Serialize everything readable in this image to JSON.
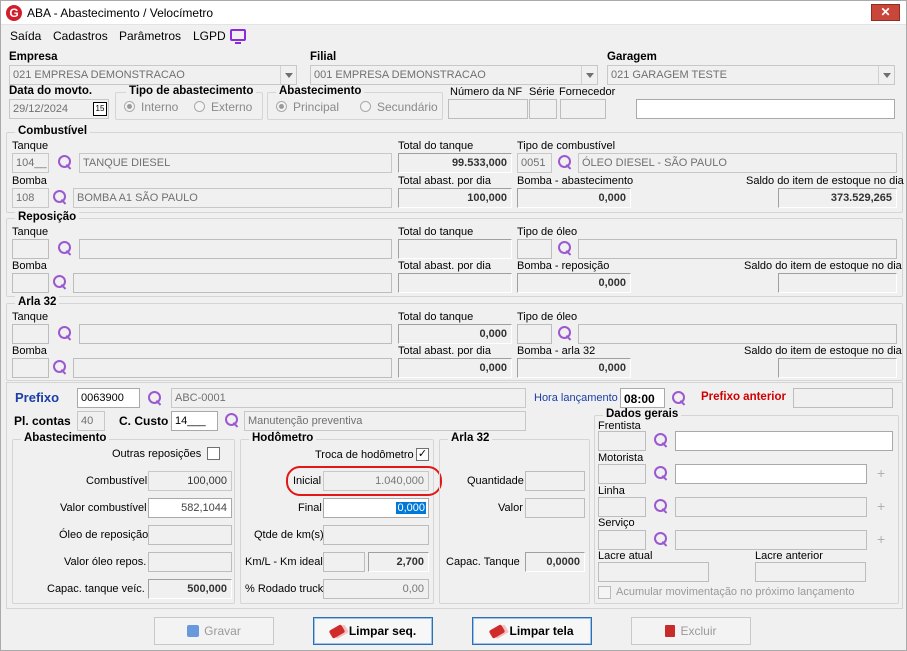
{
  "window": {
    "title": "ABA - Abastecimento / Velocímetro",
    "close_label": "✕"
  },
  "menu": [
    {
      "label": "Saída"
    },
    {
      "label": "Cadastros"
    },
    {
      "label": "Parâmetros"
    },
    {
      "label": "LGPD"
    }
  ],
  "header": {
    "empresa_label": "Empresa",
    "empresa_value": "021 EMPRESA DEMONSTRACAO",
    "filial_label": "Filial",
    "filial_value": "001 EMPRESA DEMONSTRACAO",
    "garagem_label": "Garagem",
    "garagem_value": "021 GARAGEM TESTE",
    "data_label": "Data do movto.",
    "data_value": "29/12/2024",
    "date_btn": "15",
    "tipo_label": "Tipo de abastecimento",
    "tipo_interno": "Interno",
    "tipo_externo": "Externo",
    "abast_label": "Abastecimento",
    "abast_principal": "Principal",
    "abast_secundario": "Secundário",
    "nf_label": "Número da NF",
    "serie_label": "Série",
    "fornecedor_label": "Fornecedor"
  },
  "combustivel": {
    "title": "Combustível",
    "tanque_label": "Tanque",
    "tanque_code": "104__",
    "tanque_name": "TANQUE DIESEL",
    "total_tanque_label": "Total do tanque",
    "total_tanque": "99.533,000",
    "tipo_label": "Tipo de combustível",
    "tipo_code": "0051",
    "tipo_name": "ÓLEO DIESEL - SÃO PAULO",
    "bomba_label": "Bomba",
    "bomba_code": "108",
    "bomba_name": "BOMBA A1 SÃO PAULO",
    "total_abast_label": "Total abast. por dia",
    "total_abast": "100,000",
    "bomba_abast_label": "Bomba - abastecimento",
    "bomba_abast": "0,000",
    "saldo_label": "Saldo do item de estoque no dia",
    "saldo": "373.529,265"
  },
  "reposicao": {
    "title": "Reposição",
    "tanque_label": "Tanque",
    "total_tanque_label": "Total do tanque",
    "tipo_label": "Tipo de óleo",
    "bomba_label": "Bomba",
    "total_abast_label": "Total abast. por dia",
    "bomba_rep_label": "Bomba - reposição",
    "bomba_rep": "0,000",
    "saldo_label": "Saldo do item de estoque no dia"
  },
  "arla": {
    "title": "Arla 32",
    "tanque_label": "Tanque",
    "total_tanque_label": "Total do tanque",
    "total_tanque": "0,000",
    "tipo_label": "Tipo de óleo",
    "bomba_label": "Bomba",
    "total_abast_label": "Total abast. por dia",
    "total_abast": "0,000",
    "bomba_arla_label": "Bomba - arla 32",
    "bomba_arla": "0,000",
    "saldo_label": "Saldo do item de estoque no dia"
  },
  "prefixo": {
    "label": "Prefixo",
    "code": "0063900",
    "name": "ABC-0001",
    "hora_label": "Hora lançamento",
    "hora": "08:00",
    "anterior_label": "Prefixo anterior",
    "pl_contas_label": "Pl. contas",
    "pl_contas": "40",
    "custo_label": "C. Custo",
    "custo_code": "14___",
    "custo_name": "Manutenção preventiva"
  },
  "abastecimento": {
    "title": "Abastecimento",
    "outras_label": "Outras reposições",
    "combustivel_label": "Combustível",
    "combustivel": "100,000",
    "valor_label": "Valor combustível",
    "valor": "582,1044",
    "oleo_label": "Óleo de reposição",
    "valor_oleo_label": "Valor óleo repos.",
    "capac_label": "Capac. tanque veíc.",
    "capac": "500,000"
  },
  "hodometro": {
    "title": "Hodômetro",
    "troca_label": "Troca de hodômetro",
    "troca_mark": "✓",
    "inicial_label": "Inicial",
    "inicial": "1.040,000",
    "final_label": "Final",
    "final": "0,000",
    "qtde_label": "Qtde de km(s)",
    "kml_label": "Km/L - Km ideal",
    "kml": "2,700",
    "rodado_label": "% Rodado truck",
    "rodado": "0,00"
  },
  "arla32": {
    "title": "Arla 32",
    "quantidade_label": "Quantidade",
    "valor_label": "Valor",
    "capac_label": "Capac. Tanque",
    "capac": "0,0000"
  },
  "dados_gerais": {
    "title": "Dados gerais",
    "frentista_label": "Frentista",
    "motorista_label": "Motorista",
    "linha_label": "Linha",
    "servico_label": "Serviço",
    "lacre_atual_label": "Lacre atual",
    "lacre_anterior_label": "Lacre anterior",
    "acumular_label": "Acumular movimentação no próximo lançamento"
  },
  "buttons": {
    "gravar": "Gravar",
    "limpar_seq": "Limpar seq.",
    "limpar_tela": "Limpar tela",
    "excluir": "Excluir"
  }
}
